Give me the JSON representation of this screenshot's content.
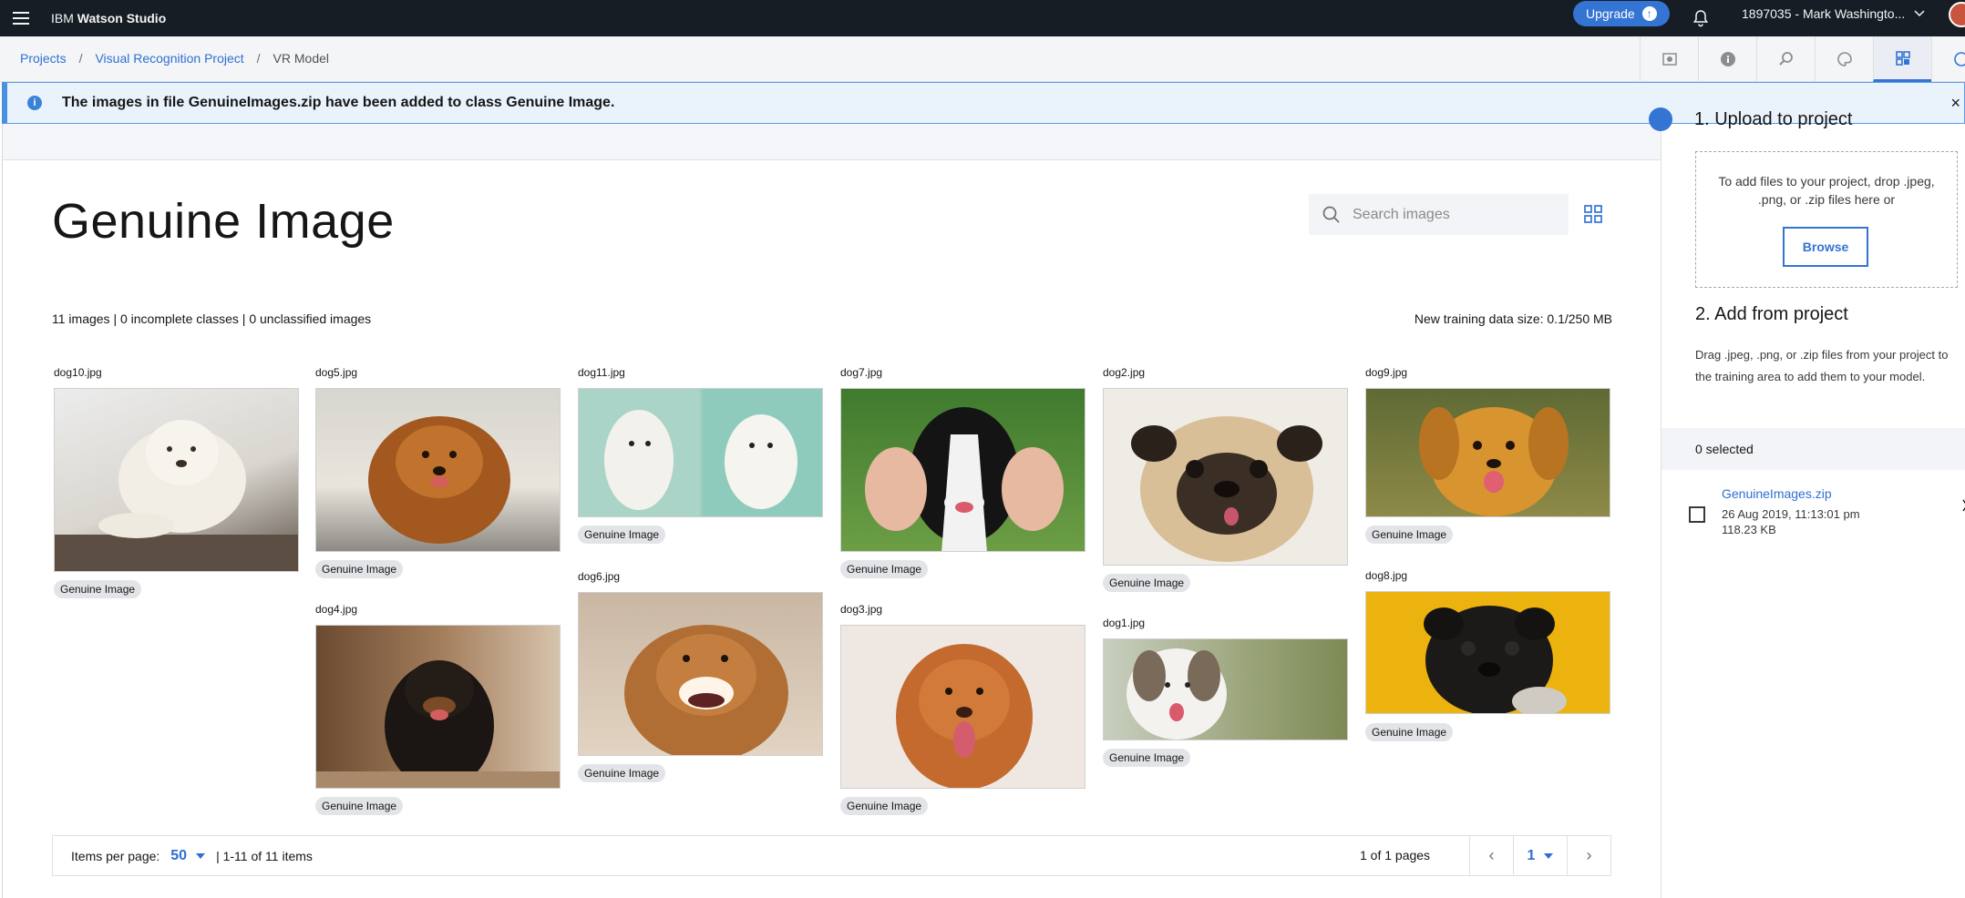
{
  "app": {
    "brand_prefix": "IBM",
    "brand_name": "Watson Studio"
  },
  "topbar": {
    "upgrade_label": "Upgrade",
    "account_label": "1897035 - Mark Washingto..."
  },
  "breadcrumb": {
    "items": [
      "Projects",
      "Visual Recognition Project",
      "VR Model"
    ],
    "separator": "/"
  },
  "notification": {
    "message": "The images in file GenuineImages.zip have been added to class Genuine Image.",
    "close_glyph": "×"
  },
  "main": {
    "title": "Genuine Image",
    "search_placeholder": "Search images",
    "summary": "11 images | 0 incomplete classes | 0 unclassified images",
    "training_size": "New training data size: 0.1/250 MB"
  },
  "images": [
    {
      "name": "dog10.jpg",
      "tag": "Genuine Image"
    },
    {
      "name": "dog5.jpg",
      "tag": "Genuine Image"
    },
    {
      "name": "dog4.jpg",
      "tag": "Genuine Image"
    },
    {
      "name": "dog11.jpg",
      "tag": "Genuine Image"
    },
    {
      "name": "dog6.jpg",
      "tag": "Genuine Image"
    },
    {
      "name": "dog7.jpg",
      "tag": "Genuine Image"
    },
    {
      "name": "dog3.jpg",
      "tag": "Genuine Image"
    },
    {
      "name": "dog2.jpg",
      "tag": "Genuine Image"
    },
    {
      "name": "dog1.jpg",
      "tag": "Genuine Image"
    },
    {
      "name": "dog9.jpg",
      "tag": "Genuine Image"
    },
    {
      "name": "dog8.jpg",
      "tag": "Genuine Image"
    }
  ],
  "pagination": {
    "items_per_page_label": "Items per page:",
    "items_per_page": "50",
    "range": "| 1-11 of 11 items",
    "pages_label": "1 of 1 pages",
    "current_page": "1",
    "prev_glyph": "‹",
    "next_glyph": "›"
  },
  "side_panel": {
    "upload_title": "1. Upload to project",
    "drop_text": "To add files to your project, drop .jpeg, .png, or .zip files here or",
    "browse_label": "Browse",
    "add_title": "2. Add from project",
    "add_desc": "Drag .jpeg, .png, or .zip files from your project to the training area to add them to your model.",
    "selected_label": "0 selected",
    "file": {
      "name": "GenuineImages.zip",
      "date": "26 Aug 2019, 11:13:01 pm",
      "size": "118.23 KB"
    }
  },
  "colors": {
    "topbar": "#161d25",
    "accent": "#3474d3",
    "link": "#2f6fd3",
    "notification_bg": "#eaf3fc",
    "tag_bg": "#e2e4e8"
  },
  "icons": [
    "menu-icon",
    "upgrade-arrow-icon",
    "bell-icon",
    "chevron-down-icon",
    "info-icon",
    "close-icon",
    "search-icon",
    "grid-view-icon"
  ]
}
